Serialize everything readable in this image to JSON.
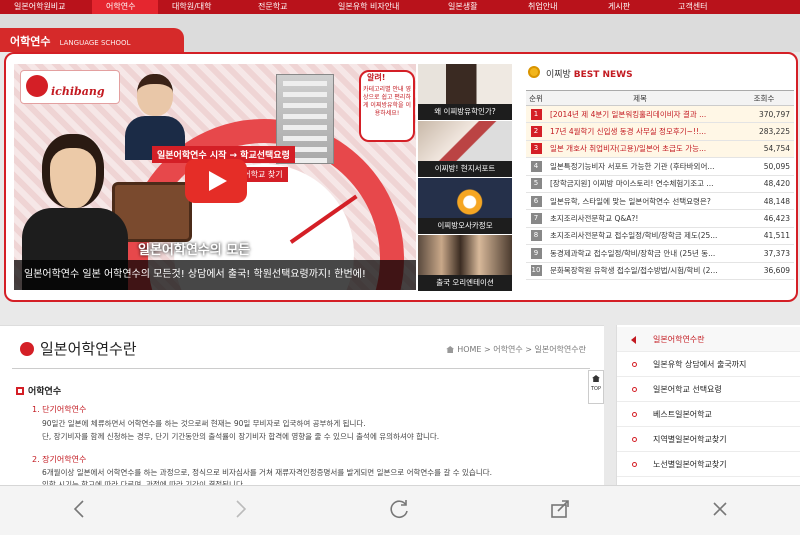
{
  "topnav": {
    "items": [
      "일본어학원비교",
      "어학연수",
      "대학원/대학",
      "전문학교",
      "일본유학 비자안내",
      "일본생활",
      "취업안내",
      "게시판",
      "고객센터"
    ]
  },
  "section_tab": {
    "title": "어학연수",
    "subtitle": "LANGUAGE SCHOOL"
  },
  "video": {
    "logo_text": "ichibang",
    "speech_q": "알려!",
    "speech_text": "카테고리별 안내 영상으로 쉽고 편리하게 이찌방유학을 이용하세요!",
    "overlay1": "일본어학연수 시작 → 학교선택요령",
    "overlay2": "지역별 다양한 어학교 찾기",
    "overlay3": "일본어학연수의 모든",
    "caption": "일본어학연수  일본 어학연수의 모든것! 상담에서 출국! 학원선택요령까지! 한번에!"
  },
  "thumbs": [
    {
      "caption": "왜 이찌방유학인가?"
    },
    {
      "caption": "이찌방! 현지서포트"
    },
    {
      "caption": "이찌방오사카정모"
    },
    {
      "caption": "출국 오리엔테이션"
    }
  ],
  "bestnews": {
    "label_prefix": "이찌방",
    "label_highlight": "BEST NEWS",
    "columns": {
      "rank": "순위",
      "title": "제목",
      "views": "조회수"
    },
    "rows": [
      {
        "rank": "1",
        "title": "[2014년 제 4분기 일본워킹홀리데이비자 결과 ...",
        "views": "370,797",
        "hot": true
      },
      {
        "rank": "2",
        "title": "17년 4월학기 신입생 동경 사무실 정모후기~!!...",
        "views": "283,225",
        "hot": true
      },
      {
        "rank": "3",
        "title": "일본 개호사 취업비자(고용)/일본어 초급도 가능...",
        "views": "54,754",
        "hot": true
      },
      {
        "rank": "4",
        "title": "일본특정기능비자 서포트 가능한 기관 (후타바외어...",
        "views": "50,095",
        "hot": false
      },
      {
        "rank": "5",
        "title": "[장학금지원] 이찌방 마이스토리! 연수체험기조고 ...",
        "views": "48,420",
        "hot": false
      },
      {
        "rank": "6",
        "title": "일본유학, 스타일에 맞는 일본어학연수 선택요령은?",
        "views": "48,148",
        "hot": false
      },
      {
        "rank": "7",
        "title": "초지조리사전문학교 Q&A?!",
        "views": "46,423",
        "hot": false
      },
      {
        "rank": "8",
        "title": "초지조리사전문학교 접수일정/학비/장학금 제도(25...",
        "views": "41,511",
        "hot": false
      },
      {
        "rank": "9",
        "title": "동경제과학교 접수일정/학비/장학금 안내 (25년 동...",
        "views": "37,373",
        "hot": false
      },
      {
        "rank": "10",
        "title": "문화복장학원 유학생 접수일/접수방법/시험/학비 (2...",
        "views": "36,609",
        "hot": false
      }
    ]
  },
  "content": {
    "page_title": "일본어학연수란",
    "breadcrumb": "HOME > 어학연수 > 일본어학연수란",
    "heading": "어학연수",
    "s1_title": "1. 단기어학연수",
    "s1_p1": "90일간 일본에 체류하면서 어학연수를 하는 것으로써 현재는 90일 무비자로 입국하여 공부하게 됩니다.",
    "s1_p2": "단, 장기비자를 함께 신청하는 경우, 단기 기간동안의 출석률이 장기비자 합격에 영향을 줄 수 있으니 출석에 유의하셔야 합니다.",
    "s2_title": "2. 장기어학연수",
    "s2_p1": "6개월이상 일본에서 어학연수를 하는 과정으로, 정식으로 비자심사를 거쳐 재류자격인정증명서를 발게되면 일본으로 어학연수를 갈 수 있습니다.",
    "s2_p2": "입학 시기는 학교에 따라 다르며, 과정에 따라 기간이 결정됩니다."
  },
  "topbtn": {
    "label": "TOP"
  },
  "rightmenu": {
    "items": [
      "일본어학연수란",
      "일본유학 상담에서 출국까지",
      "일본어학교 선택요령",
      "베스트일본어학교",
      "지역별일본어학교찾기",
      "노선별일본어학교찾기"
    ]
  },
  "colors": {
    "brand": "#d41f26",
    "nav": "#b9121b",
    "toolbar": "#f4f4f4"
  },
  "toolbar": {
    "icons": [
      "back-icon",
      "forward-icon",
      "reload-icon",
      "share-icon",
      "close-icon"
    ]
  }
}
